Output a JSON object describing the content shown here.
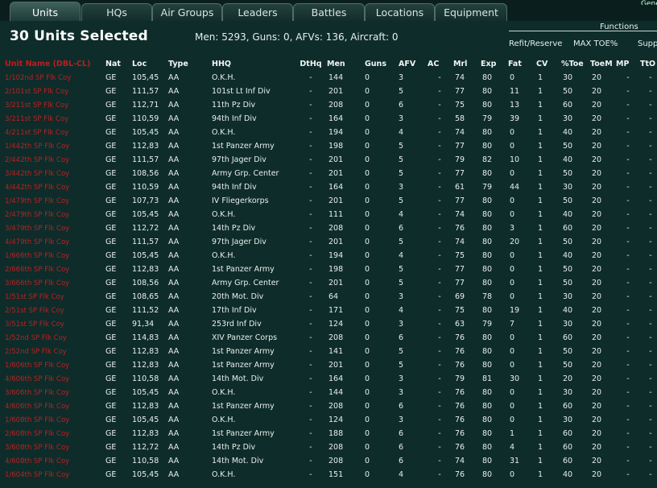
{
  "tabs": [
    {
      "label": "Units",
      "active": true
    },
    {
      "label": "HQs",
      "active": false
    },
    {
      "label": "Air Groups",
      "active": false
    },
    {
      "label": "Leaders",
      "active": false
    },
    {
      "label": "Battles",
      "active": false
    },
    {
      "label": "Locations",
      "active": false
    },
    {
      "label": "Equipment",
      "active": false
    }
  ],
  "corner_text": "Genera",
  "header": {
    "title": "30 Units Selected",
    "summary": "Men: 5293, Guns: 0, AFVs: 136, Aircraft: 0",
    "functions_label": "Functions",
    "buttons": [
      "Refit/Reserve",
      "MAX TOE%",
      "Supp"
    ]
  },
  "columns": [
    "Unit Name (DBL-CL)",
    "Nat",
    "Loc",
    "Type",
    "HHQ",
    "DtHq",
    "Men",
    "Guns",
    "AFV",
    "AC",
    "Mrl",
    "Exp",
    "Fat",
    "CV",
    "%Toe",
    "ToeM",
    "MP",
    "TtO"
  ],
  "colors": {
    "unit_name": "#b82222",
    "background": "#0e2c2a"
  },
  "rows": [
    [
      "1/102nd SP Flk Coy",
      "GE",
      "105,45",
      "AA",
      "O.K.H.",
      "-",
      "144",
      "0",
      "3",
      "-",
      "74",
      "80",
      "0",
      "1",
      "30",
      "20",
      "-",
      "-"
    ],
    [
      "2/101st SP Flk Coy",
      "GE",
      "111,57",
      "AA",
      "101st Lt Inf Div",
      "-",
      "201",
      "0",
      "5",
      "-",
      "77",
      "80",
      "11",
      "1",
      "50",
      "20",
      "-",
      "-"
    ],
    [
      "3/211st SP Flk Coy",
      "GE",
      "112,71",
      "AA",
      "11th Pz Div",
      "-",
      "208",
      "0",
      "6",
      "-",
      "75",
      "80",
      "13",
      "1",
      "60",
      "20",
      "-",
      "-"
    ],
    [
      "3/211st SP Flk Coy",
      "GE",
      "110,59",
      "AA",
      "94th Inf Div",
      "-",
      "164",
      "0",
      "3",
      "-",
      "58",
      "79",
      "39",
      "1",
      "30",
      "20",
      "-",
      "-"
    ],
    [
      "4/211st SP Flk Coy",
      "GE",
      "105,45",
      "AA",
      "O.K.H.",
      "-",
      "194",
      "0",
      "4",
      "-",
      "74",
      "80",
      "0",
      "1",
      "40",
      "20",
      "-",
      "-"
    ],
    [
      "1/442th SP Flk Coy",
      "GE",
      "112,83",
      "AA",
      "1st Panzer Army",
      "-",
      "198",
      "0",
      "5",
      "-",
      "77",
      "80",
      "0",
      "1",
      "50",
      "20",
      "-",
      "-"
    ],
    [
      "2/442th SP Flk Coy",
      "GE",
      "111,57",
      "AA",
      "97th Jager Div",
      "-",
      "201",
      "0",
      "5",
      "-",
      "79",
      "82",
      "10",
      "1",
      "40",
      "20",
      "-",
      "-"
    ],
    [
      "3/442th SP Flk Coy",
      "GE",
      "108,56",
      "AA",
      "Army Grp. Center",
      "-",
      "201",
      "0",
      "5",
      "-",
      "77",
      "80",
      "0",
      "1",
      "50",
      "20",
      "-",
      "-"
    ],
    [
      "4/442th SP Flk Coy",
      "GE",
      "110,59",
      "AA",
      "94th Inf Div",
      "-",
      "164",
      "0",
      "3",
      "-",
      "61",
      "79",
      "44",
      "1",
      "30",
      "20",
      "-",
      "-"
    ],
    [
      "1/479th SP Flk Coy",
      "GE",
      "107,73",
      "AA",
      "IV Fliegerkorps",
      "-",
      "201",
      "0",
      "5",
      "-",
      "77",
      "80",
      "0",
      "1",
      "50",
      "20",
      "-",
      "-"
    ],
    [
      "2/479th SP Flk Coy",
      "GE",
      "105,45",
      "AA",
      "O.K.H.",
      "-",
      "111",
      "0",
      "4",
      "-",
      "74",
      "80",
      "0",
      "1",
      "40",
      "20",
      "-",
      "-"
    ],
    [
      "3/479th SP Flk Coy",
      "GE",
      "112,72",
      "AA",
      "14th Pz Div",
      "-",
      "208",
      "0",
      "6",
      "-",
      "76",
      "80",
      "3",
      "1",
      "60",
      "20",
      "-",
      "-"
    ],
    [
      "4/479th SP Flk Coy",
      "GE",
      "111,57",
      "AA",
      "97th Jager Div",
      "-",
      "201",
      "0",
      "5",
      "-",
      "74",
      "80",
      "20",
      "1",
      "50",
      "20",
      "-",
      "-"
    ],
    [
      "1/666th SP Flk Coy",
      "GE",
      "105,45",
      "AA",
      "O.K.H.",
      "-",
      "194",
      "0",
      "4",
      "-",
      "75",
      "80",
      "0",
      "1",
      "40",
      "20",
      "-",
      "-"
    ],
    [
      "2/666th SP Flk Coy",
      "GE",
      "112,83",
      "AA",
      "1st Panzer Army",
      "-",
      "198",
      "0",
      "5",
      "-",
      "77",
      "80",
      "0",
      "1",
      "50",
      "20",
      "-",
      "-"
    ],
    [
      "3/666th SP Flk Coy",
      "GE",
      "108,56",
      "AA",
      "Army Grp. Center",
      "-",
      "201",
      "0",
      "5",
      "-",
      "77",
      "80",
      "0",
      "1",
      "50",
      "20",
      "-",
      "-"
    ],
    [
      "1/51st SP Flk Coy",
      "GE",
      "108,65",
      "AA",
      "20th Mot. Div",
      "-",
      "64",
      "0",
      "3",
      "-",
      "69",
      "78",
      "0",
      "1",
      "30",
      "20",
      "-",
      "-"
    ],
    [
      "2/51st SP Flk Coy",
      "GE",
      "111,52",
      "AA",
      "17th Inf Div",
      "-",
      "171",
      "0",
      "4",
      "-",
      "75",
      "80",
      "19",
      "1",
      "40",
      "20",
      "-",
      "-"
    ],
    [
      "3/51st SP Flk Coy",
      "GE",
      "91,34",
      "AA",
      "253rd Inf Div",
      "-",
      "124",
      "0",
      "3",
      "-",
      "63",
      "79",
      "7",
      "1",
      "30",
      "20",
      "-",
      "-"
    ],
    [
      "1/52nd SP Flk Coy",
      "GE",
      "114,83",
      "AA",
      "XIV Panzer Corps",
      "-",
      "208",
      "0",
      "6",
      "-",
      "76",
      "80",
      "0",
      "1",
      "60",
      "20",
      "-",
      "-"
    ],
    [
      "2/52nd SP Flk Coy",
      "GE",
      "112,83",
      "AA",
      "1st Panzer Army",
      "-",
      "141",
      "0",
      "5",
      "-",
      "76",
      "80",
      "0",
      "1",
      "50",
      "20",
      "-",
      "-"
    ],
    [
      "1/606th SP Flk Coy",
      "GE",
      "112,83",
      "AA",
      "1st Panzer Army",
      "-",
      "201",
      "0",
      "5",
      "-",
      "76",
      "80",
      "0",
      "1",
      "50",
      "20",
      "-",
      "-"
    ],
    [
      "4/606th SP Flk Coy",
      "GE",
      "110,58",
      "AA",
      "14th Mot. Div",
      "-",
      "164",
      "0",
      "3",
      "-",
      "79",
      "81",
      "30",
      "1",
      "20",
      "20",
      "-",
      "-"
    ],
    [
      "3/606th SP Flk Coy",
      "GE",
      "105,45",
      "AA",
      "O.K.H.",
      "-",
      "144",
      "0",
      "3",
      "-",
      "76",
      "80",
      "0",
      "1",
      "30",
      "20",
      "-",
      "-"
    ],
    [
      "4/606th SP Flk Coy",
      "GE",
      "112,83",
      "AA",
      "1st Panzer Army",
      "-",
      "208",
      "0",
      "6",
      "-",
      "76",
      "80",
      "0",
      "1",
      "60",
      "20",
      "-",
      "-"
    ],
    [
      "1/608th SP Flk Coy",
      "GE",
      "105,45",
      "AA",
      "O.K.H.",
      "-",
      "124",
      "0",
      "3",
      "-",
      "76",
      "80",
      "0",
      "1",
      "30",
      "20",
      "-",
      "-"
    ],
    [
      "2/608th SP Flk Coy",
      "GE",
      "112,83",
      "AA",
      "1st Panzer Army",
      "-",
      "188",
      "0",
      "6",
      "-",
      "76",
      "80",
      "1",
      "1",
      "60",
      "20",
      "-",
      "-"
    ],
    [
      "3/608th SP Flk Coy",
      "GE",
      "112,72",
      "AA",
      "14th Pz Div",
      "-",
      "208",
      "0",
      "6",
      "-",
      "76",
      "80",
      "4",
      "1",
      "60",
      "20",
      "-",
      "-"
    ],
    [
      "4/608th SP Flk Coy",
      "GE",
      "110,58",
      "AA",
      "14th Mot. Div",
      "-",
      "208",
      "0",
      "6",
      "-",
      "74",
      "80",
      "31",
      "1",
      "60",
      "20",
      "-",
      "-"
    ],
    [
      "1/604th SP Flk Coy",
      "GE",
      "105,45",
      "AA",
      "O.K.H.",
      "-",
      "151",
      "0",
      "4",
      "-",
      "76",
      "80",
      "0",
      "1",
      "40",
      "20",
      "-",
      "-"
    ]
  ]
}
